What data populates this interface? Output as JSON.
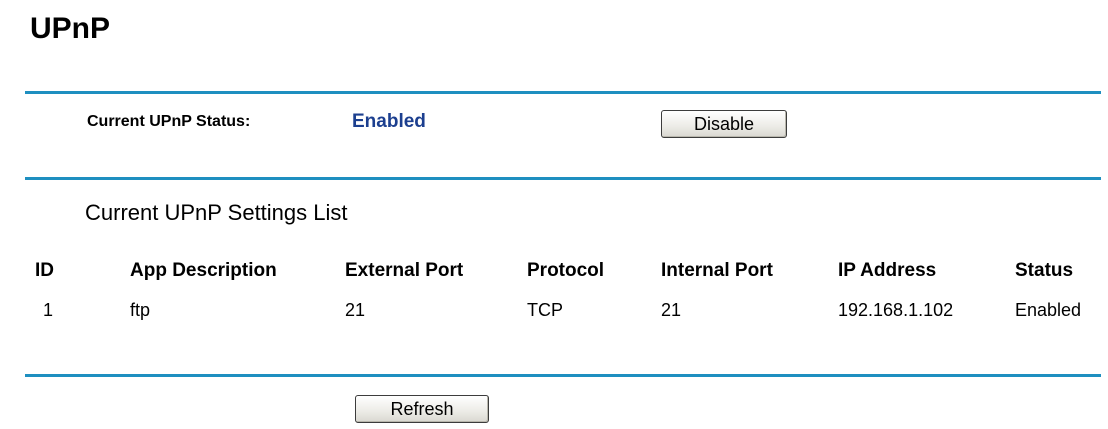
{
  "page": {
    "title": "UPnP"
  },
  "status_section": {
    "label": "Current UPnP Status:",
    "value": "Enabled",
    "toggle_button_label": "Disable"
  },
  "settings_list": {
    "title": "Current UPnP Settings List",
    "columns": [
      "ID",
      "App Description",
      "External Port",
      "Protocol",
      "Internal Port",
      "IP Address",
      "Status"
    ],
    "rows": [
      [
        "1",
        "ftp",
        "21",
        "TCP",
        "21",
        "192.168.1.102",
        "Enabled"
      ]
    ]
  },
  "actions": {
    "refresh_label": "Refresh"
  },
  "colors": {
    "divider": "#1e8fc0",
    "status_value": "#1c3f8f"
  }
}
